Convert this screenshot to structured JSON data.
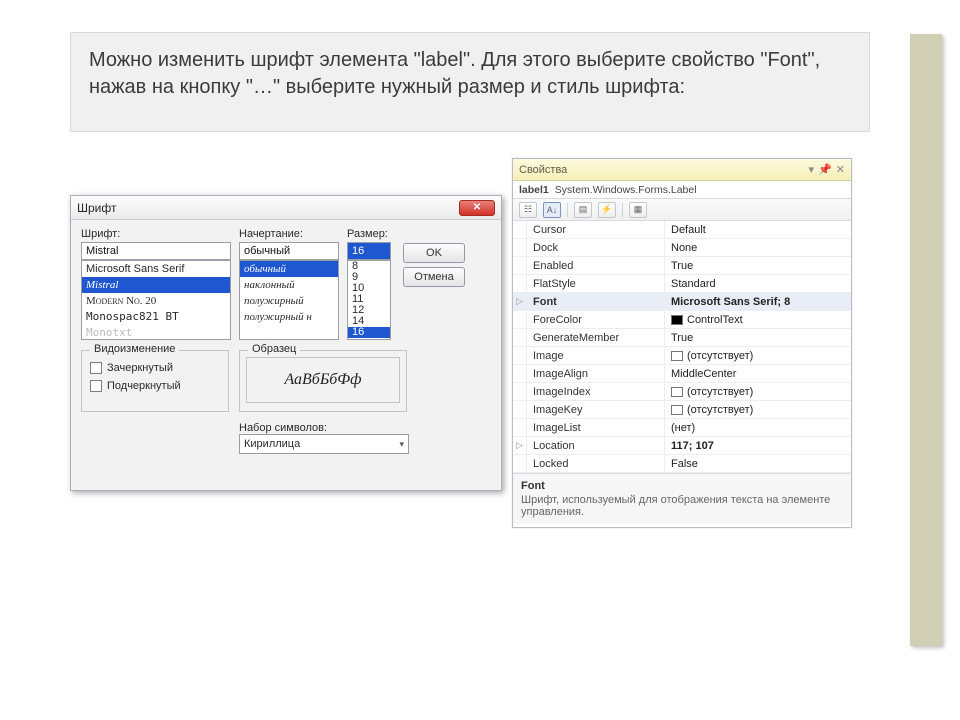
{
  "instruction": "Можно изменить шрифт элемента \"label\". Для этого выберите свойство \"Font\", нажав на кнопку \"…\" выберите нужный размер и стиль шрифта:",
  "fontDialog": {
    "title": "Шрифт",
    "labels": {
      "font": "Шрифт:",
      "style": "Начертание:",
      "size": "Размер:"
    },
    "buttons": {
      "ok": "OK",
      "cancel": "Отмена"
    },
    "fontInput": "Mistral",
    "fontList": [
      "Microsoft Sans Serif",
      "Mistral",
      "Modern No. 20",
      "Monospac821 BT",
      "Monotxt"
    ],
    "fontSelected": "Mistral",
    "styleInput": "обычный",
    "styleList": [
      "обычный",
      "наклонный",
      "полужирный",
      "полужирный н"
    ],
    "styleSelected": "обычный",
    "sizeInput": "16",
    "sizeList": [
      "8",
      "9",
      "10",
      "11",
      "12",
      "14",
      "16"
    ],
    "sizeSelected": "16",
    "effects": {
      "legend": "Видоизменение",
      "strike": "Зачеркнутый",
      "under": "Подчеркнутый"
    },
    "sampleLegend": "Образец",
    "sampleText": "АаВбБбФф",
    "scriptLegend": "Набор символов:",
    "scriptValue": "Кириллица"
  },
  "props": {
    "header": "Свойства",
    "obj": {
      "name": "label1",
      "type": "System.Windows.Forms.Label"
    },
    "rows": [
      {
        "k": "Cursor",
        "v": "Default"
      },
      {
        "k": "Dock",
        "v": "None"
      },
      {
        "k": "Enabled",
        "v": "True"
      },
      {
        "k": "FlatStyle",
        "v": "Standard"
      },
      {
        "k": "Font",
        "v": "Microsoft Sans Serif; 8",
        "bold": true,
        "exp": "▷"
      },
      {
        "k": "ForeColor",
        "v": "ControlText",
        "swatch": "black"
      },
      {
        "k": "GenerateMember",
        "v": "True"
      },
      {
        "k": "Image",
        "v": "(отсутствует)",
        "swatch": "none"
      },
      {
        "k": "ImageAlign",
        "v": "MiddleCenter"
      },
      {
        "k": "ImageIndex",
        "v": "(отсутствует)",
        "swatch": "none"
      },
      {
        "k": "ImageKey",
        "v": "(отсутствует)",
        "swatch": "none"
      },
      {
        "k": "ImageList",
        "v": "(нет)"
      },
      {
        "k": "Location",
        "v": "117; 107",
        "bold": true,
        "exp": "▷"
      },
      {
        "k": "Locked",
        "v": "False"
      }
    ],
    "desc": {
      "title": "Font",
      "text": "Шрифт, используемый для отображения текста на элементе управления."
    }
  }
}
